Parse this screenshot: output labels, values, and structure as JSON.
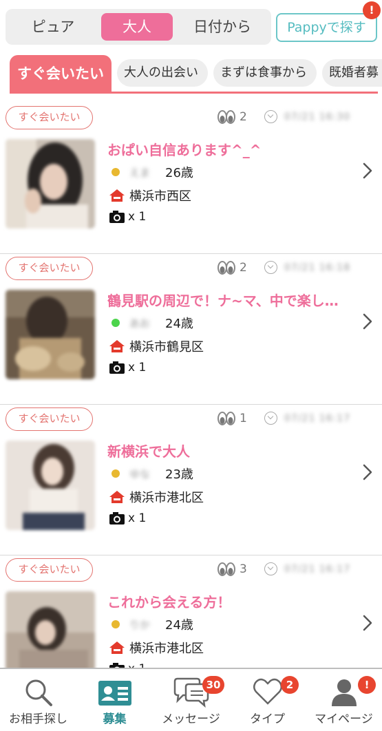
{
  "segment": {
    "items": [
      "ピュア",
      "大人",
      "日付から"
    ],
    "selected": "大人"
  },
  "pappy": {
    "label": "Pappyで探す",
    "badge": "!"
  },
  "category_tabs": [
    "すぐ会いたい",
    "大人の出会い",
    "まずは食事から",
    "既婚者募"
  ],
  "posts": [
    {
      "tag": "すぐ会いたい",
      "views": "2",
      "title": "おぱい自信あります^_^",
      "status_color": "#e8b830",
      "age": "26歳",
      "area": "横浜市西区",
      "photos": "x 1"
    },
    {
      "tag": "すぐ会いたい",
      "views": "2",
      "title": "鶴見駅の周辺で！ナ~マ、中で楽し…",
      "status_color": "#4cd44c",
      "age": "24歳",
      "area": "横浜市鶴見区",
      "photos": "x 1"
    },
    {
      "tag": "すぐ会いたい",
      "views": "1",
      "title": "新横浜で大人",
      "status_color": "#e8b830",
      "age": "23歳",
      "area": "横浜市港北区",
      "photos": "x 1"
    },
    {
      "tag": "すぐ会いたい",
      "views": "3",
      "title": "これから会える方！",
      "status_color": "#e8b830",
      "age": "24歳",
      "area": "横浜市港北区",
      "photos": "x 1"
    }
  ],
  "bottom_nav": {
    "items": [
      {
        "label": "お相手探し",
        "icon": "search-icon"
      },
      {
        "label": "募集",
        "icon": "id-card-icon"
      },
      {
        "label": "メッセージ",
        "icon": "chat-bubble-icon",
        "badge": "30"
      },
      {
        "label": "タイプ",
        "icon": "heart-icon",
        "badge": "2"
      },
      {
        "label": "マイページ",
        "icon": "person-icon",
        "badge": "!"
      }
    ],
    "active": "募集"
  },
  "colors": {
    "accent_pink": "#ee6e9a",
    "tab_red": "#f2707a",
    "teal": "#2f8e94",
    "badge_red": "#e8452f"
  }
}
